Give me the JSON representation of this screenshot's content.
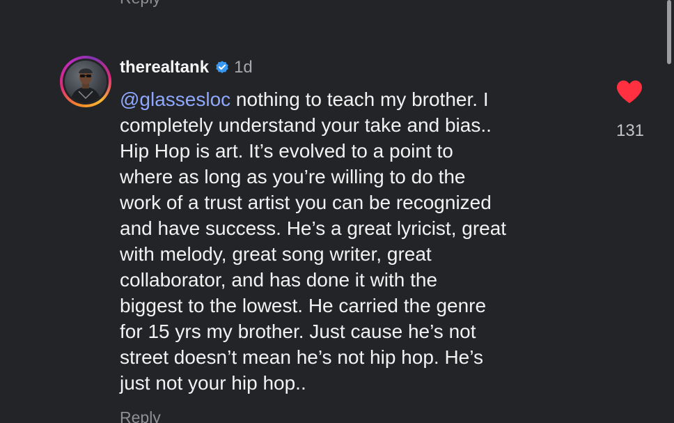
{
  "previous": {
    "reply_label": "Reply"
  },
  "comment": {
    "username": "therealtank",
    "verified": true,
    "time": "1d",
    "mention": "@glassesloc",
    "lines": [
      " nothing to teach my brother. I",
      "completely understand your take and bias..",
      "Hip Hop is art. It’s evolved to a point to",
      "where as long as you’re willing to do the",
      "work of a trust artist you can be recognized",
      "and have success. He’s a great lyricist, great",
      "with melody, great song writer, great",
      "collaborator, and has done it with the",
      "biggest to the lowest. He carried the genre",
      "for 15 yrs my brother. Just cause he’s not",
      "street doesn’t mean he’s not hip hop. He’s",
      "just not your hip hop.."
    ],
    "likes": "131",
    "reply_label": "Reply"
  },
  "icons": {
    "like": "heart-icon",
    "verified": "verified-badge-icon",
    "avatar": "avatar"
  },
  "colors": {
    "background": "#232427",
    "mention": "#8ea7ff",
    "heart": "#ff3040",
    "verified": "#3897f0",
    "secondary_text": "#8e8f94"
  }
}
